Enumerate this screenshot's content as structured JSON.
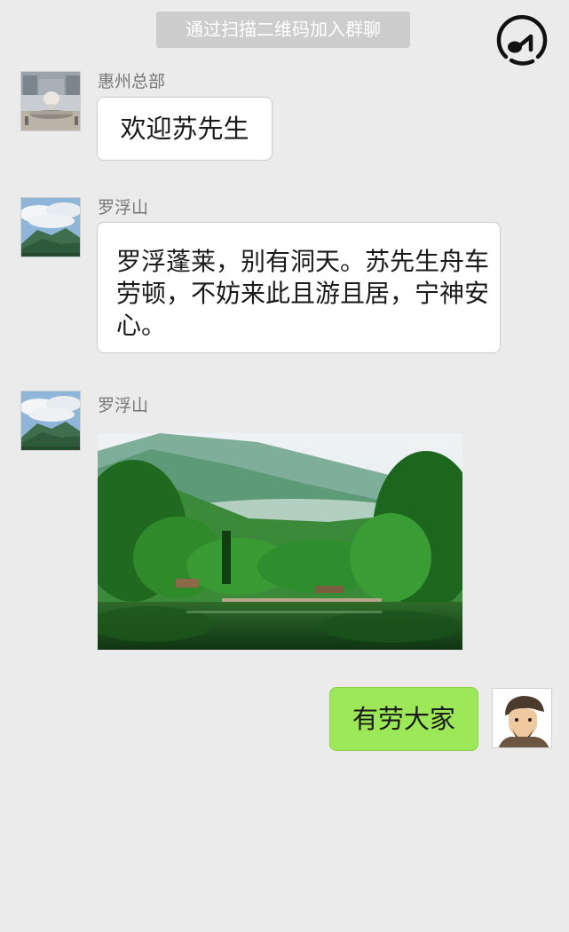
{
  "header": {
    "join_notice": "通过扫描二维码加入群聊",
    "music_icon": "music-note-icon"
  },
  "messages": [
    {
      "sender": "惠州总部",
      "avatar_icon": "plaza-fountain-avatar",
      "text": "欢迎苏先生"
    },
    {
      "sender": "罗浮山",
      "avatar_icon": "mountain-avatar",
      "text": "罗浮蓬莱，别有洞天。苏先生舟车劳顿，不妨来此且游且居，宁神安心。"
    },
    {
      "sender": "罗浮山",
      "avatar_icon": "mountain-avatar",
      "image_icon": "mountain-lake-photo"
    },
    {
      "self": true,
      "avatar_icon": "su-dongpo-portrait-avatar",
      "text": "有劳大家"
    }
  ],
  "colors": {
    "background": "#ebebeb",
    "notice_bg": "#cdcdcd",
    "incoming_bubble": "#ffffff",
    "outgoing_bubble": "#9de858"
  }
}
